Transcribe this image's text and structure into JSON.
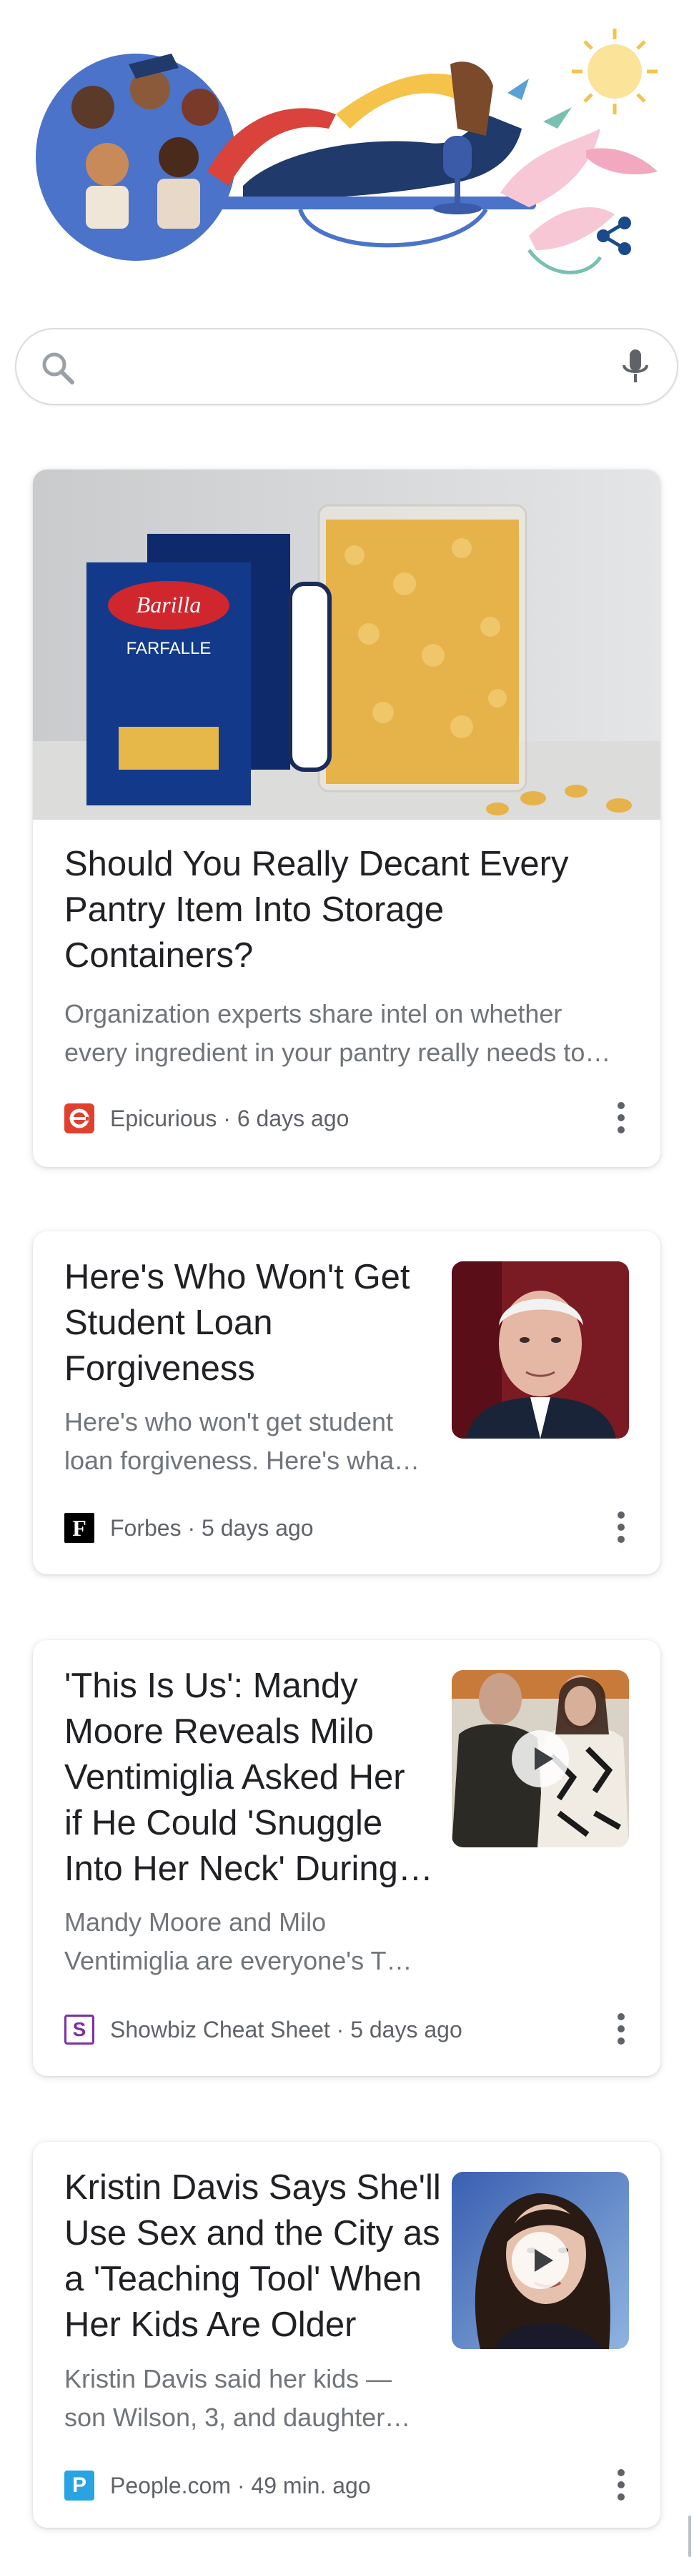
{
  "doodle": {
    "share_label": "Share"
  },
  "search": {
    "placeholder": "",
    "value": ""
  },
  "cards": [
    {
      "title_lines": [
        "Should You Really Decant Every",
        "Pantry Item Into Storage",
        "Containers?"
      ],
      "snippet_lines": [
        "Organization experts share intel on whether",
        "every ingredient in your pantry really needs to…"
      ],
      "source": "Epicurious",
      "age": "6 days ago",
      "image": {
        "brand": "Barilla",
        "product": "FARFALLE"
      }
    },
    {
      "title_lines": [
        "Here's Who Won't Get",
        "Student Loan",
        "Forgiveness"
      ],
      "snippet_lines": [
        "Here's who won't get student",
        "loan forgiveness. Here's wha…"
      ],
      "source": "Forbes",
      "age": "5 days ago",
      "favicon_letter": "F"
    },
    {
      "title_lines": [
        "'This Is Us': Mandy",
        "Moore Reveals Milo",
        "Ventimiglia Asked Her",
        "if He Could 'Snuggle",
        "Into Her Neck' During…"
      ],
      "snippet_lines": [
        "Mandy Moore and Milo",
        "Ventimiglia are everyone's T…"
      ],
      "source": "Showbiz Cheat Sheet",
      "age": "5 days ago",
      "favicon_letter": "S"
    },
    {
      "title_lines": [
        "Kristin Davis Says She'll",
        "Use Sex and the City as",
        "a 'Teaching Tool' When",
        "Her Kids Are Older"
      ],
      "snippet_lines": [
        "Kristin Davis said her kids —",
        "son Wilson, 3, and daughter…"
      ],
      "source": "People.com",
      "age": "49 min. ago",
      "favicon_letter": "P"
    }
  ],
  "separator": "·",
  "colors": {
    "epicurious": "#e0412f",
    "forbes": "#000000",
    "showbiz": "#7b2fa8",
    "people": "#2aa3e3"
  }
}
